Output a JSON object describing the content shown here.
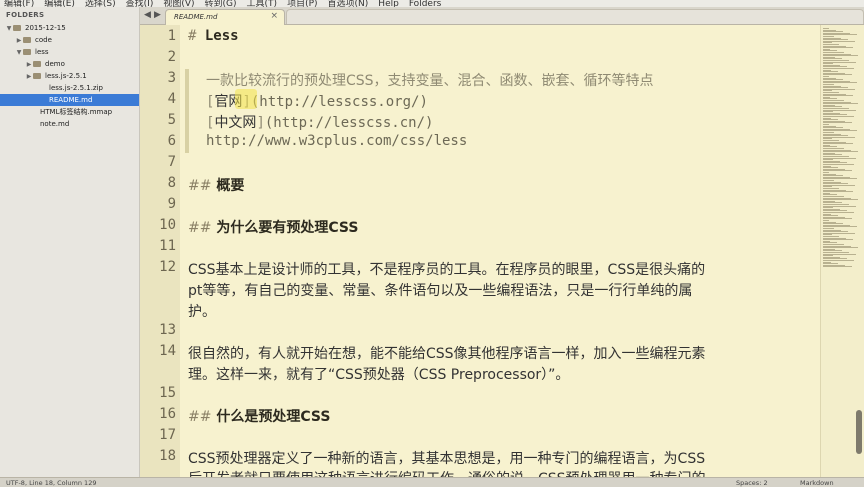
{
  "menu": [
    "编辑(F)",
    "编辑(E)",
    "选择(S)",
    "查找(I)",
    "视图(V)",
    "转到(G)",
    "工具(T)",
    "项目(P)",
    "首选项(N)",
    "Help",
    "Folders"
  ],
  "sidebar": {
    "header": "FOLDERS",
    "items": [
      {
        "label": "2015-12-15"
      },
      {
        "label": "code"
      },
      {
        "label": "less"
      },
      {
        "label": "demo"
      },
      {
        "label": "less.js-2.5.1"
      },
      {
        "label": "less.js-2.5.1.zip"
      },
      {
        "label": "README.md"
      },
      {
        "label": "HTML标签结构.mmap"
      },
      {
        "label": "note.md"
      }
    ]
  },
  "tabbar": {
    "back": "◀",
    "forward": "▶",
    "tab_title": "README.md",
    "tab_close": "×"
  },
  "editor": {
    "lines": [
      {
        "n": "1",
        "hash": "#",
        "text": "Less"
      },
      {
        "n": "2",
        "text": ""
      },
      {
        "n": "3",
        "text": "一款比较流行的预处理CSS，支持变量、混合、函数、嵌套、循环等特点"
      },
      {
        "n": "4",
        "open": "[",
        "link": "官网",
        "close": "]",
        "url": "(http://lesscss.org/)"
      },
      {
        "n": "5",
        "open": "[",
        "link": "中文网",
        "close": "]",
        "url": "(http://lesscss.cn/)"
      },
      {
        "n": "6",
        "text": "http://www.w3cplus.com/css/less"
      },
      {
        "n": "7",
        "text": ""
      },
      {
        "n": "8",
        "hash": "##",
        "text": "概要"
      },
      {
        "n": "9",
        "text": ""
      },
      {
        "n": "10",
        "hash": "##",
        "text": "为什么要有预处理CSS"
      },
      {
        "n": "11",
        "text": ""
      },
      {
        "n": "12",
        "text": "CSS基本上是设计师的工具，不是程序员的工具。在程序员的眼里，CSS是很头痛的",
        "cont1": "pt等等，有自己的变量、常量、条件语句以及一些编程语法，只是一行行单纯的属",
        "cont2": "护。"
      },
      {
        "n": "13",
        "text": ""
      },
      {
        "n": "14",
        "text": "很自然的，有人就开始在想，能不能给CSS像其他程序语言一样，加入一些编程元素",
        "cont1": "理。这样一来，就有了“CSS预处器（CSS Preprocessor）”。"
      },
      {
        "n": "15",
        "text": ""
      },
      {
        "n": "16",
        "hash": "##",
        "text": "什么是预处理CSS"
      },
      {
        "n": "17",
        "text": ""
      },
      {
        "n": "18",
        "text": "CSS预处理器定义了一种新的语言，其基本思想是，用一种专门的编程语言，为CSS",
        "cont1": "后开发者就只要使用这种语言进行编码工作。通俗的说，CSS预处理器用一种专门的"
      }
    ]
  },
  "status": {
    "left": "UTF-8, Line 18, Column 129",
    "spaces": "Spaces: 2",
    "syntax": "Markdown"
  }
}
